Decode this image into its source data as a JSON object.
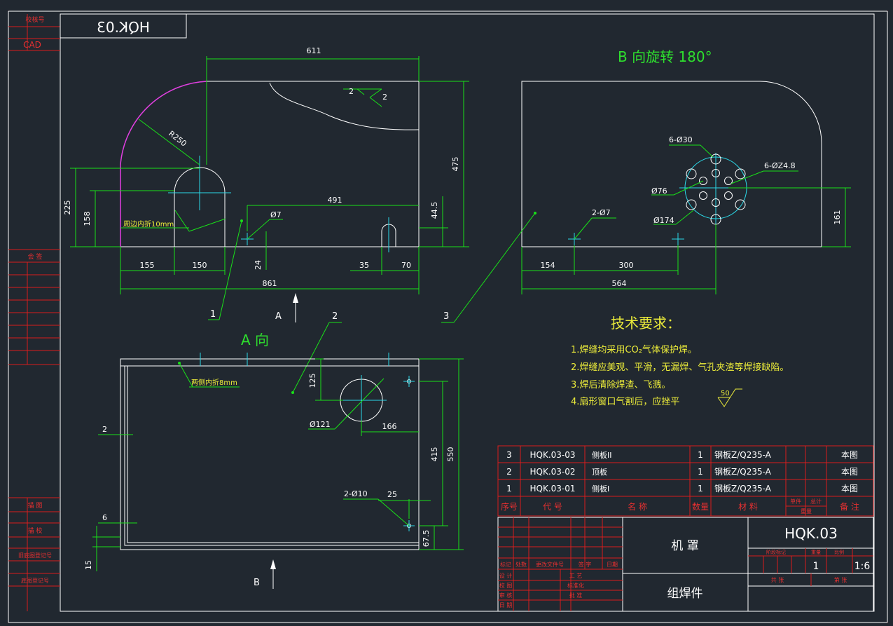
{
  "title_box_top": "HQK.03",
  "side_labels": {
    "top1": "校核号",
    "top2": "CAD",
    "mid": "会  签",
    "b1": "描  图",
    "b2": "描  校",
    "b3": "旧底图登记号",
    "b4": "底图登记号"
  },
  "view_b_title": "B  向旋转 180°",
  "view_a_title": "A  向",
  "arrow_a": "A",
  "arrow_b": "B",
  "dims_top": {
    "d611": "611",
    "d475": "475",
    "d225": "225",
    "d158": "158",
    "r250": "R250",
    "d491": "491",
    "d44": "44.5",
    "phi7": "Ø7",
    "d24": "24",
    "d155": "155",
    "d150": "150",
    "d35": "35",
    "d70": "70",
    "d861": "861",
    "weld_a": "2",
    "weld_b": "2",
    "fold_note": "周边内折10mm"
  },
  "dims_right": {
    "six_phi30": "6-Ø30",
    "six_phi248": "6-ØZ4.8",
    "phi76": "Ø76",
    "phi174": "Ø174",
    "two_phi7": "2-Ø7",
    "d161": "161",
    "d154": "154",
    "d300": "300",
    "d564": "564"
  },
  "dims_a": {
    "fold_note": "两侧内折8mm",
    "d125": "125",
    "phi121": "Ø121",
    "d166": "166",
    "d2": "2",
    "d415": "415",
    "d550": "550",
    "two_phi10": "2-Ø10",
    "d25": "25",
    "d6": "6",
    "d67": "67.5",
    "d15": "15"
  },
  "leaders": {
    "p1": "1",
    "p2": "2",
    "p3": "3"
  },
  "tech": {
    "heading": "技术要求：",
    "l1": "1.焊缝均采用CO₂气体保护焊。",
    "l2": "2.焊缝应美观、平滑，无漏焊、气孔夹渣等焊接缺陷。",
    "l3": "3.焊后清除焊渣、飞溅。",
    "l4": "4.扇形窗口气割后，应挫平",
    "rough": "50"
  },
  "bom": {
    "rows": [
      {
        "no": "3",
        "code": "HQK.03-03",
        "name": "侧板II",
        "qty": "1",
        "material": "钢板Z/Q235-A",
        "note": "本图"
      },
      {
        "no": "2",
        "code": "HQK.03-02",
        "name": "顶板",
        "qty": "1",
        "material": "钢板Z/Q235-A",
        "note": "本图"
      },
      {
        "no": "1",
        "code": "HQK.03-01",
        "name": "侧板I",
        "qty": "1",
        "material": "钢板Z/Q235-A",
        "note": "本图"
      }
    ],
    "headers": {
      "no": "序号",
      "code": "代  号",
      "name": "名      称",
      "qty": "数量",
      "material": "材    料",
      "w1": "单件",
      "w2": "总计",
      "w3": "重量",
      "note": "备  注"
    }
  },
  "titleblock": {
    "drawing_no": "HQK.03",
    "name1": "机 罩",
    "name2": "组焊件",
    "qty": "1",
    "scale": "1:6",
    "stage": "阶段标记",
    "weight": "重量",
    "ratio": "比例",
    "sheets1": "共    张",
    "sheets2": "第    张",
    "rev": {
      "mark": "标记",
      "count": "处数",
      "doc": "更改文件号",
      "sign": "签  字",
      "date": "日期"
    },
    "roles": {
      "design": "设 计",
      "check": "校 图",
      "review": "审 核",
      "date": "日 期",
      "process": "工  艺",
      "std": "标准化",
      "approve": "批  准"
    }
  },
  "colors": {
    "background": "#212830",
    "outline": "#ffffff",
    "dimension": "#19e119",
    "centerline": "#2bd9e8",
    "frame": "#d91d1d",
    "text": "#ecec3a",
    "arc": "#e03ee0"
  }
}
